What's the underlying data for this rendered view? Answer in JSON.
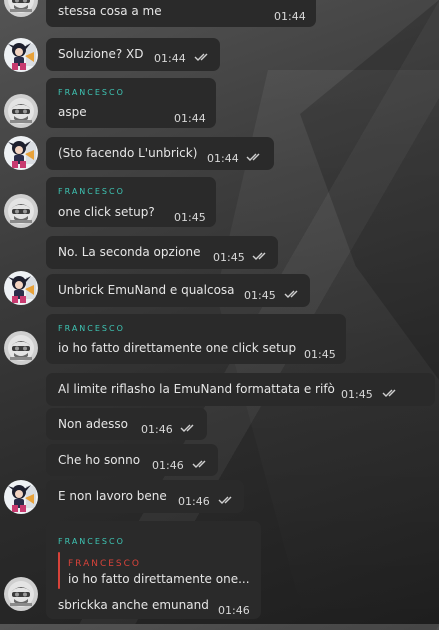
{
  "chat": {
    "messages": [
      {
        "text": "stessa cosa a me",
        "time": "01:44"
      },
      {
        "text": "Soluzione? XD",
        "time": "01:44"
      },
      {
        "sender": "FRANCESCO",
        "text": "aspe",
        "time": "01:44"
      },
      {
        "text": "(Sto facendo L'unbrick)",
        "time": "01:44"
      },
      {
        "sender": "FRANCESCO",
        "text": "one click setup?",
        "time": "01:45"
      },
      {
        "text": "No. La seconda opzione",
        "time": "01:45"
      },
      {
        "text": "Unbrick EmuNand e qualcosa",
        "time": "01:45"
      },
      {
        "sender": "FRANCESCO",
        "text": "io ho fatto direttamente one click setup",
        "time": "01:45"
      },
      {
        "text": "Al limite riflasho la EmuNand formattata e rifò",
        "time": "01:45"
      },
      {
        "text": "Non adesso",
        "time": "01:46"
      },
      {
        "text": "Che ho sonno",
        "time": "01:46"
      },
      {
        "text": "E non lavoro bene",
        "time": "01:46"
      },
      {
        "sender": "FRANCESCO",
        "reply_sender": "FRANCESCO",
        "reply_text": "io ho fatto direttamente one...",
        "text": "sbrickka anche emunand",
        "time": "01:46"
      }
    ]
  },
  "colors": {
    "sender": "#3ec6b5",
    "reply": "#d8433a",
    "bubble": "#2a2a2a",
    "ticks": "#d0d0d0"
  }
}
